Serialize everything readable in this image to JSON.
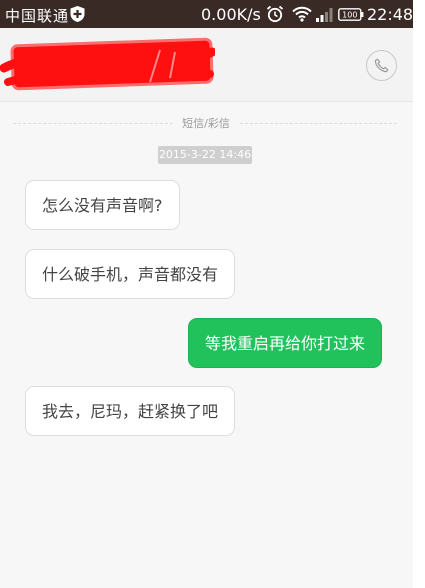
{
  "status_bar": {
    "carrier": "中国联通",
    "net_speed": "0.00K/s",
    "battery": "100",
    "time": "22:48",
    "bg_color": "#3a2a25"
  },
  "header": {
    "contact_name": "",
    "call_icon": "phone-icon"
  },
  "thread": {
    "divider_label": "短信/彩信",
    "timestamp": "2015-3-22 14:46",
    "messages": [
      {
        "direction": "incoming",
        "text": "怎么没有声音啊?"
      },
      {
        "direction": "incoming",
        "text": "什么破手机，声音都没有"
      },
      {
        "direction": "outgoing",
        "text": "等我重启再给你打过来"
      },
      {
        "direction": "incoming",
        "text": "我去，尼玛，赶紧换了吧"
      }
    ]
  },
  "colors": {
    "outgoing_bubble": "#21c25c",
    "incoming_bubble": "#ffffff",
    "redaction": "#ff1010"
  }
}
